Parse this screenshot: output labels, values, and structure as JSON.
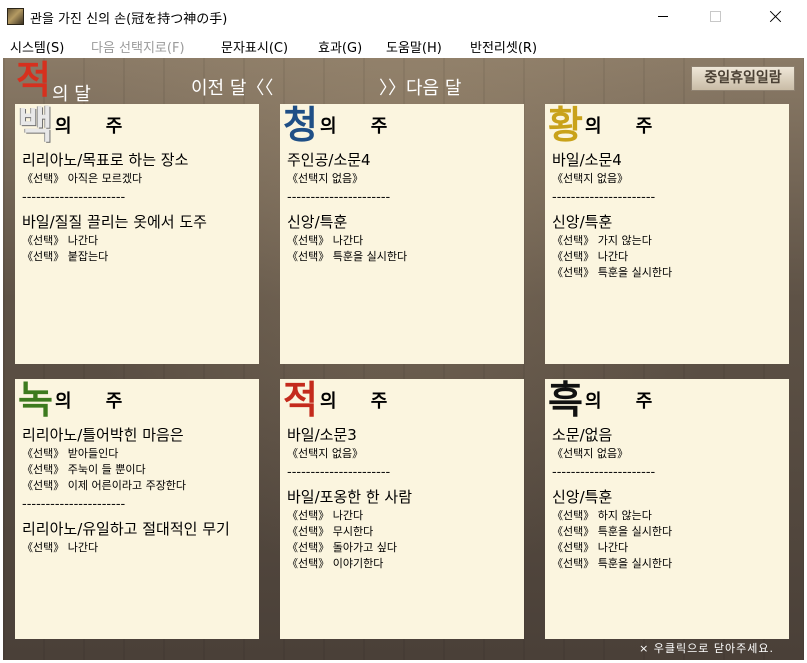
{
  "window": {
    "title": "관을 가진 신의 손(冠を持つ神の手)"
  },
  "menu": [
    {
      "label": "시스템(S)",
      "enabled": true
    },
    {
      "label": "다음 선택지로(F)",
      "enabled": false
    },
    {
      "label": "문자표시(C)",
      "enabled": true
    },
    {
      "label": "효과(G)",
      "enabled": true
    },
    {
      "label": "도움말(H)",
      "enabled": true
    },
    {
      "label": "반전리셋(R)",
      "enabled": true
    }
  ],
  "header": {
    "month_char": "적",
    "month_char_color": "#d6301e",
    "month_suffix": "의 달",
    "prev_label": "이전 달〈〈",
    "next_label": "〉〉다음 달",
    "holiday_button": "중일휴일일람"
  },
  "weeks": [
    {
      "char": "백",
      "color": "#e8e8e8",
      "suffix": "의 주",
      "blocks": [
        {
          "title": "리리아노/목표로 하는 장소",
          "choices": [
            "《선택》 아직은 모르겠다"
          ]
        },
        {
          "title": "바일/질질 끌리는 옷에서 도주",
          "choices": [
            "《선택》 나간다",
            "《선택》 붙잡는다"
          ]
        }
      ]
    },
    {
      "char": "청",
      "color": "#1f4f86",
      "suffix": "의 주",
      "blocks": [
        {
          "title": "주인공/소문4",
          "choices": [
            "《선택지 없음》"
          ]
        },
        {
          "title": "신앙/특훈",
          "choices": [
            "《선택》 나간다",
            "《선택》 특훈을 실시한다"
          ]
        }
      ]
    },
    {
      "char": "황",
      "color": "#c9a21a",
      "suffix": "의 주",
      "blocks": [
        {
          "title": "바일/소문4",
          "choices": [
            "《선택지 없음》"
          ]
        },
        {
          "title": "신앙/특훈",
          "choices": [
            "《선택》 가지 않는다",
            "《선택》 나간다",
            "《선택》 특훈을 실시한다"
          ]
        }
      ]
    },
    {
      "char": "녹",
      "color": "#3d7a1e",
      "suffix": "의 주",
      "blocks": [
        {
          "title": "리리아노/틀어박힌 마음은",
          "choices": [
            "《선택》 받아들인다",
            "《선택》 주눅이 들 뿐이다",
            "《선택》 이제 어른이라고 주장한다"
          ]
        },
        {
          "title": "리리아노/유일하고 절대적인 무기",
          "choices": [
            "《선택》 나간다"
          ]
        }
      ]
    },
    {
      "char": "적",
      "color": "#c42a1c",
      "suffix": "의 주",
      "blocks": [
        {
          "title": "바일/소문3",
          "choices": [
            "《선택지 없음》"
          ]
        },
        {
          "title": "바일/포옹한 한 사람",
          "choices": [
            "《선택》 나간다",
            "《선택》 무시한다",
            "《선택》 돌아가고 싶다",
            "《선택》 이야기한다"
          ]
        }
      ]
    },
    {
      "char": "흑",
      "color": "#111111",
      "suffix": "의 주",
      "blocks": [
        {
          "title": "소문/없음",
          "choices": [
            "《선택지 없음》"
          ]
        },
        {
          "title": "신앙/특훈",
          "choices": [
            "《선택》 하지 않는다",
            "《선택》 특훈을 실시한다",
            "《선택》 나간다",
            "《선택》 특훈을 실시한다"
          ]
        }
      ]
    }
  ],
  "separator": "----------------------",
  "footer_hint": "× 우클릭으로 닫아주세요."
}
